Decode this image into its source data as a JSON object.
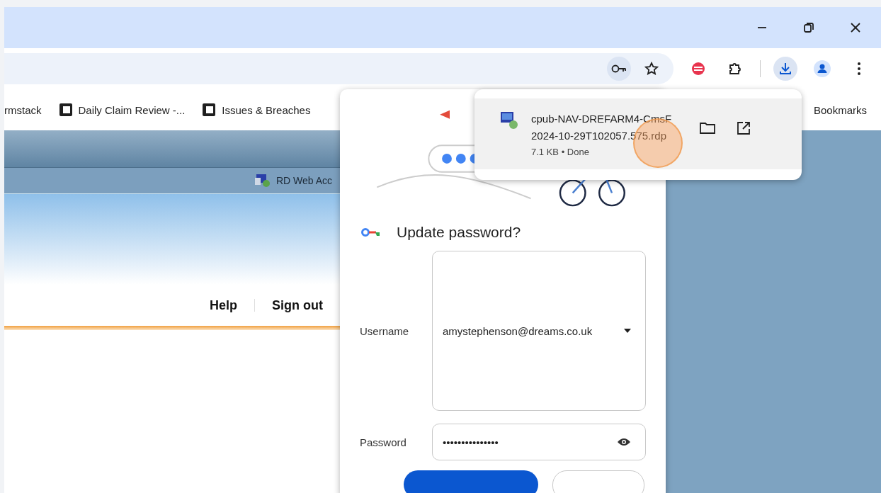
{
  "toolbar": {
    "downloads_open": true
  },
  "bookmarks": [
    {
      "label": "rmstack",
      "kind": "plain"
    },
    {
      "label": "Daily Claim Review -...",
      "kind": "page"
    },
    {
      "label": "Issues & Breaches",
      "kind": "page"
    }
  ],
  "all_bookmarks": "Bookmarks",
  "site": {
    "nav_title": "RD Web Acc",
    "links": [
      "Help",
      "Sign out"
    ]
  },
  "password_prompt": {
    "title": "Update password?",
    "username_label": "Username",
    "username": "amystephenson@dreams.co.uk",
    "password_label": "Password",
    "password": "•••••••••••••••"
  },
  "download": {
    "filename_lines": [
      "cpub-NAV-DREFARM4-CmsF",
      "2024-10-29T102057.575.rdp"
    ],
    "status": "7.1 KB • Done"
  }
}
